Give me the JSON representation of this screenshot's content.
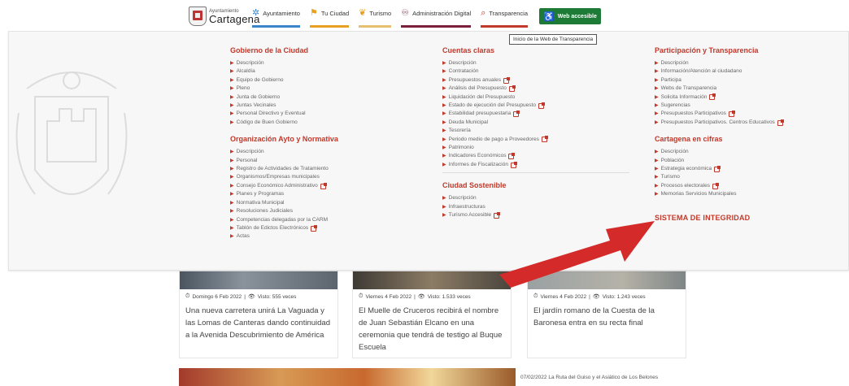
{
  "header": {
    "logo": {
      "small": "Ayuntamiento",
      "big": "Cartagena"
    },
    "nav": [
      {
        "label": "Ayuntamiento",
        "icon": "star-icon"
      },
      {
        "label": "Tu Ciudad",
        "icon": "flag-icon"
      },
      {
        "label": "Turismo",
        "icon": "leaf-icon"
      },
      {
        "label": "Administración Digital",
        "icon": "people-icon"
      },
      {
        "label": "Transparencia",
        "icon": "search-icon"
      }
    ],
    "access_button": "Web accesible"
  },
  "tooltip": "Inicio de la Web de Transparencia",
  "menu": {
    "col1": {
      "title": "Gobierno de la Ciudad",
      "items": [
        "Descripción",
        "Alcaldía",
        "Equipo de Gobierno",
        "Pleno",
        "Junta de Gobierno",
        "Juntas Vecinales",
        "Personal Directivo y Eventual",
        "Código de Buen Gobierno"
      ],
      "title2": "Organización Ayto y Normativa",
      "items2": [
        "Descripción",
        "Personal",
        "Registro de Actividades de Tratamiento",
        "Organismos/Empresas municipales",
        "Consejo Económico Administrativo",
        "Planes y Programas",
        "Normativa Municipal",
        "Resoluciones Judiciales",
        "Competencias delegadas por la CARM",
        "Tablón de Edictos Electrónicos",
        "Actas"
      ]
    },
    "col2": {
      "title": "Cuentas claras",
      "items": [
        "Descripción",
        "Contratación",
        "Presupuestos anuales",
        "Análisis del Presupuesto",
        "Liquidación del Presupuesto",
        "Estado de ejecución del Presupuesto",
        "Estabilidad presupuestaria",
        "Deuda Municipal",
        "Tesorería",
        "Periodo medio de pago a Proveedores",
        "Patrimonio",
        "Indicadores Económicos",
        "Informes de Fiscalización"
      ],
      "title2": "Ciudad Sostenible",
      "items2": [
        "Descripción",
        "Infraestructuras",
        "Turismo Accesible"
      ]
    },
    "col3": {
      "title": "Participación y Transparencia",
      "items": [
        "Descripción",
        "Información/Atención al ciudadano",
        "Participa",
        "Webs de Transparencia",
        "Solicita Información",
        "Sugerencias",
        "Presupuestos Participativos",
        "Presupuestos Participativos. Centros Educativos"
      ],
      "title2": "Cartagena en cifras",
      "items2": [
        "Descripción",
        "Población",
        "Estrategia económica",
        "Turismo",
        "Procesos electorales",
        "Memorias Servicios Municipales"
      ],
      "sistema": "SISTEMA DE INTEGRIDAD"
    }
  },
  "news": [
    {
      "date": "Domingo 6 Feb 2022",
      "visits": "Visto: 555 veces",
      "title": "Una nueva carretera unirá La Vaguada y las Lomas de Canteras dando continuidad a la Avenida Descubrimiento de América"
    },
    {
      "date": "Viernes 4 Feb 2022",
      "visits": "Visto: 1.533 veces",
      "title": "El Muelle de Cruceros recibirá el nombre de Juan Sebastián Elcano en una ceremonia que tendrá de testigo al Buque Escuela"
    },
    {
      "date": "Viernes 4 Feb 2022",
      "visits": "Visto: 1.243 veces",
      "title": "El jardín romano de la Cuesta de la Baronesa entra en su recta final"
    }
  ],
  "strip_text": "07/02/2022 La Ruta del Guiso y el Asiático de Los Belones",
  "colors": {
    "accent": "#c0392b",
    "access": "#1e7a37",
    "arrow": "#d42a2a"
  }
}
